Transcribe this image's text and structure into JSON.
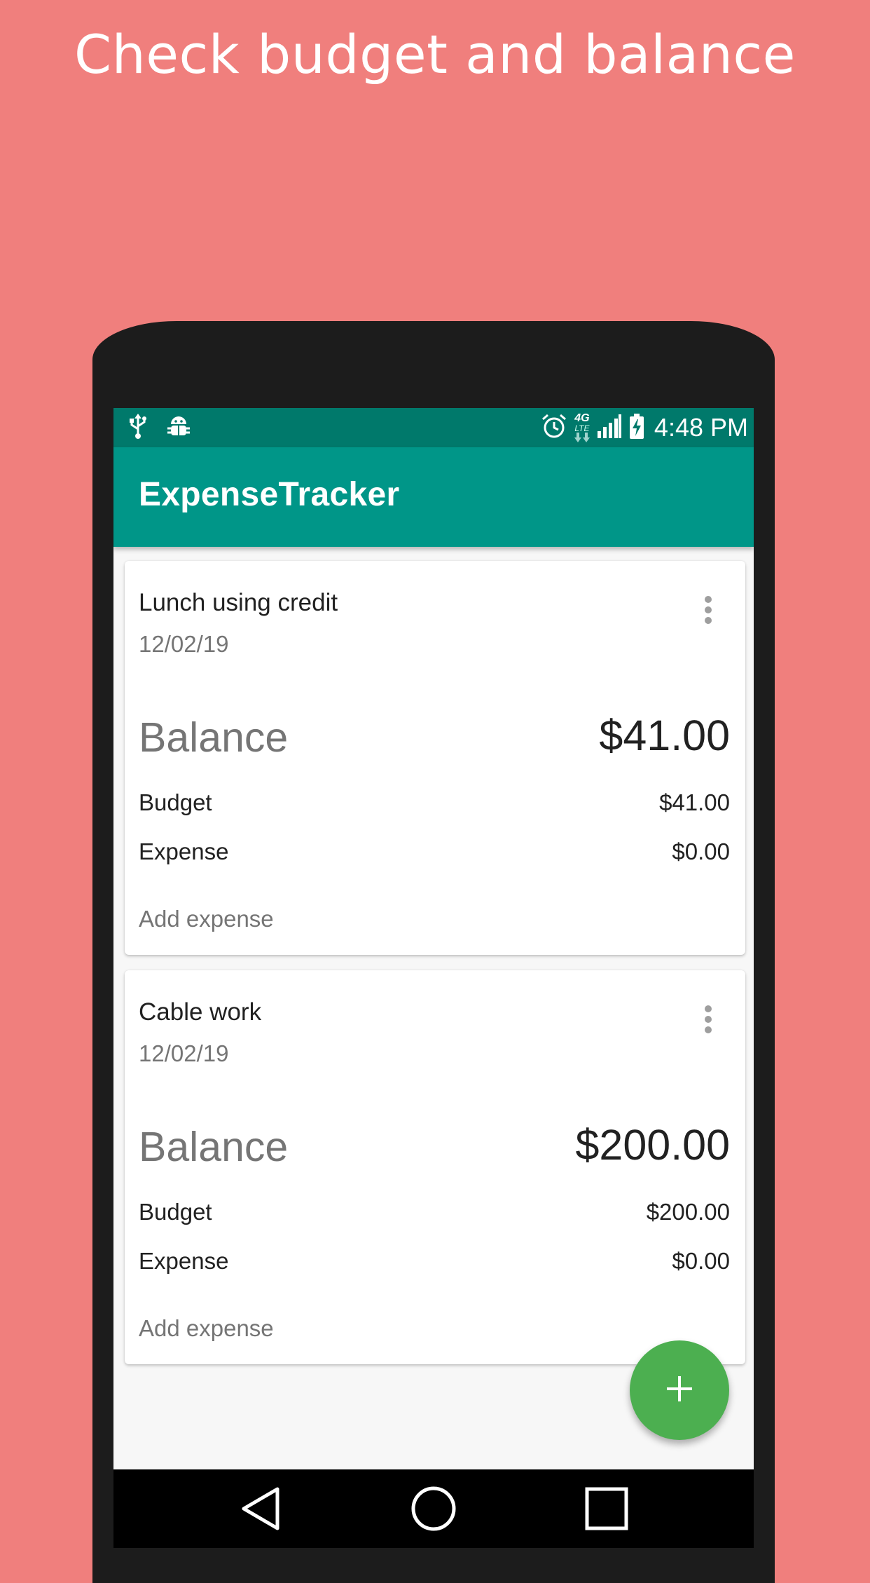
{
  "headline": "Check budget and balance",
  "status_bar": {
    "time": "4:48 PM",
    "network": "4G",
    "network_sub": "LTE",
    "icons": [
      "usb-icon",
      "android-debug-icon",
      "alarm-icon",
      "network-4g-icon",
      "signal-icon",
      "battery-charging-icon"
    ]
  },
  "app_bar": {
    "title": "ExpenseTracker"
  },
  "cards": [
    {
      "title": "Lunch using credit",
      "date": "12/02/19",
      "balance_label": "Balance",
      "balance_value": "$41.00",
      "budget_label": "Budget",
      "budget_value": "$41.00",
      "expense_label": "Expense",
      "expense_value": "$0.00",
      "add_expense_label": "Add expense"
    },
    {
      "title": "Cable work",
      "date": "12/02/19",
      "balance_label": "Balance",
      "balance_value": "$200.00",
      "budget_label": "Budget",
      "budget_value": "$200.00",
      "expense_label": "Expense",
      "expense_value": "$0.00",
      "add_expense_label": "Add expense"
    }
  ],
  "fab": {
    "icon": "plus-icon"
  },
  "nav_bar": {
    "icons": [
      "back-icon",
      "home-icon",
      "recents-icon"
    ]
  },
  "colors": {
    "background": "#F07F7D",
    "status_bar": "#00796B",
    "app_bar": "#009688",
    "fab": "#4CAF50"
  }
}
